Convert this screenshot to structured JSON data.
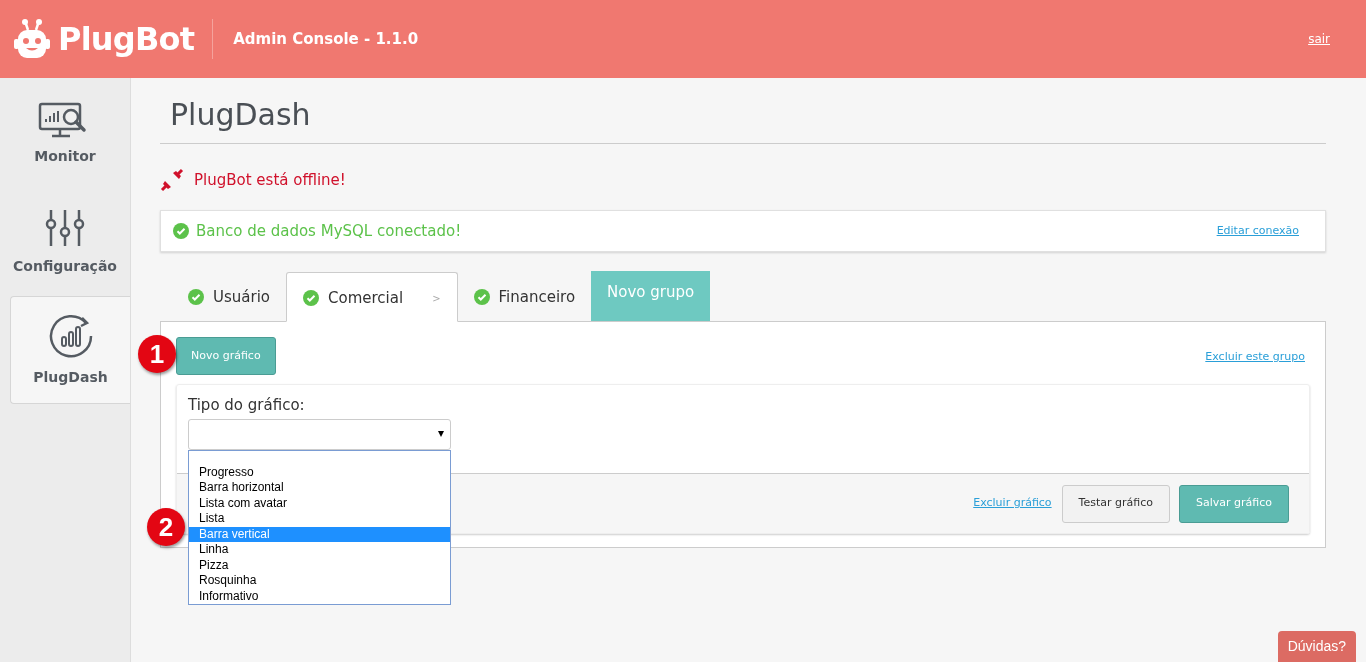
{
  "header": {
    "brand": "PlugBot",
    "subtitle": "Admin Console - 1.1.0",
    "logout": "sair"
  },
  "sidebar": {
    "items": [
      {
        "label": "Monitor",
        "kind": "monitor",
        "selected": false
      },
      {
        "label": "Configuração",
        "kind": "sliders",
        "selected": false
      },
      {
        "label": "PlugDash",
        "kind": "dash",
        "selected": true
      }
    ]
  },
  "page": {
    "title": "PlugDash",
    "offline_message": "PlugBot está offline!",
    "db_status": {
      "text": "Banco de dados MySQL conectado!",
      "link": "Editar conexão"
    }
  },
  "tabs": [
    {
      "label": "Usuário",
      "kind": "group",
      "selected": false
    },
    {
      "label": "Comercial",
      "kind": "group",
      "selected": true,
      "arrow": ">"
    },
    {
      "label": "Financeiro",
      "kind": "group",
      "selected": false
    },
    {
      "label": "Novo grupo",
      "kind": "new",
      "selected": false
    }
  ],
  "group_panel": {
    "new_chart_button": "Novo gráfico",
    "delete_group_link": "Excluir este grupo",
    "chart_form": {
      "type_label": "Tipo do gráfico:",
      "options": [
        {
          "label": "Progresso",
          "selected": false
        },
        {
          "label": "Barra horizontal",
          "selected": false
        },
        {
          "label": "Lista com avatar",
          "selected": false
        },
        {
          "label": "Lista",
          "selected": false
        },
        {
          "label": "Barra vertical",
          "selected": true
        },
        {
          "label": "Linha",
          "selected": false
        },
        {
          "label": "Pizza",
          "selected": false
        },
        {
          "label": "Rosquinha",
          "selected": false
        },
        {
          "label": "Informativo",
          "selected": false
        }
      ],
      "delete_link": "Excluir gráfico",
      "test_button": "Testar gráfico",
      "save_button": "Salvar gráfico"
    }
  },
  "step_markers": [
    "1",
    "2"
  ],
  "help_button": "Dúvidas?"
}
